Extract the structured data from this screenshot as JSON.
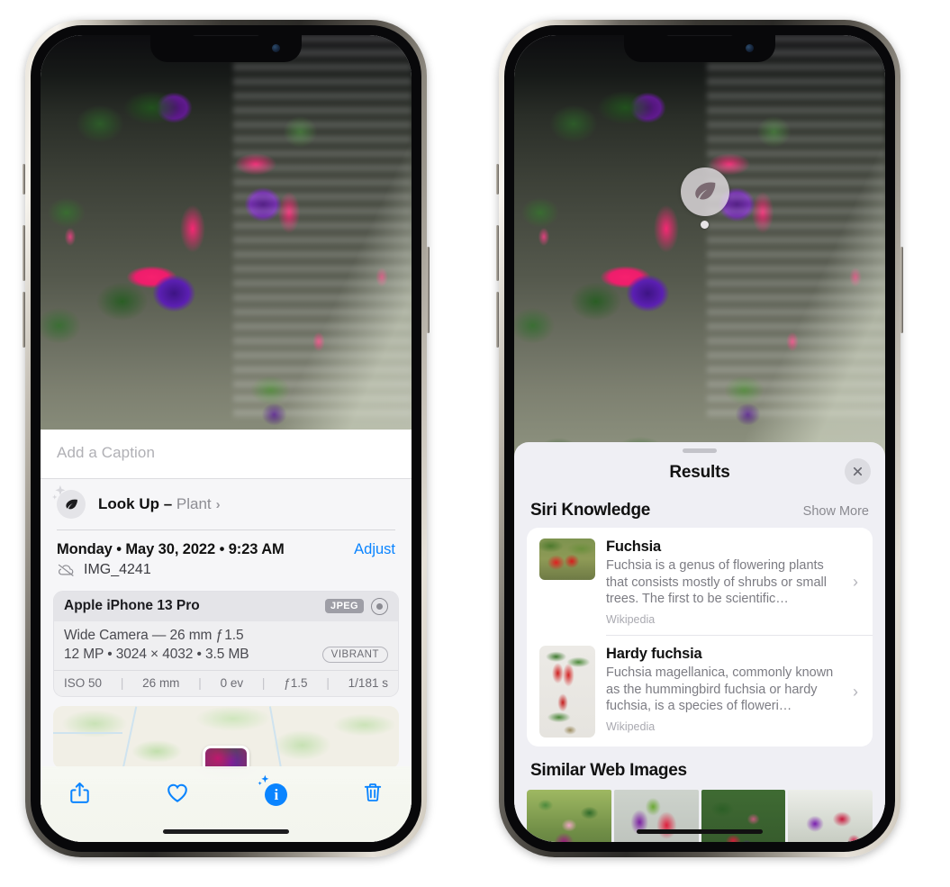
{
  "left_phone": {
    "caption_placeholder": "Add a Caption",
    "lookup": {
      "label": "Look Up – ",
      "subject": "Plant",
      "chevron": "›",
      "icon": "leaf-icon"
    },
    "meta": {
      "date": "Monday • May 30, 2022 • 9:23 AM",
      "adjust": "Adjust",
      "filename": "IMG_4241"
    },
    "camera": {
      "device": "Apple iPhone 13 Pro",
      "format_badge": "JPEG",
      "lens": "Wide Camera — 26 mm ƒ 1.5",
      "specs": "12 MP • 3024 × 4032 • 3.5 MB",
      "style_badge": "VIBRANT",
      "exif": [
        "ISO 50",
        "26 mm",
        "0 ev",
        "ƒ1.5",
        "1/181 s"
      ],
      "exif_sep": "|"
    },
    "toolbar": [
      {
        "name": "share-button",
        "glyph": "share"
      },
      {
        "name": "favorite-button",
        "glyph": "heart"
      },
      {
        "name": "info-button",
        "glyph": "info-sparkle",
        "badge_text": "i"
      },
      {
        "name": "delete-button",
        "glyph": "trash"
      }
    ]
  },
  "right_phone": {
    "visual_lookup_badge": "leaf-icon",
    "sheet": {
      "title": "Results",
      "close_label": "✕"
    },
    "siri_knowledge": {
      "section_title": "Siri Knowledge",
      "show_more": "Show More",
      "items": [
        {
          "name": "Fuchsia",
          "description": "Fuchsia is a genus of flowering plants that consists mostly of shrubs or small trees. The first to be scientific…",
          "source": "Wikipedia",
          "chevron": "›"
        },
        {
          "name": "Hardy fuchsia",
          "description": "Fuchsia magellanica, commonly known as the hummingbird fuchsia or hardy fuchsia, is a species of floweri…",
          "source": "Wikipedia",
          "chevron": "›"
        }
      ]
    },
    "similar_web_images": {
      "section_title": "Similar Web Images",
      "thumbs": [
        "web-image-1",
        "web-image-2",
        "web-image-3",
        "web-image-4"
      ]
    }
  },
  "colors": {
    "accent_blue": "#0a84ff",
    "sheet_bg": "#efeff4",
    "card_bg": "#ffffff",
    "secondary_text": "#8a8a90"
  }
}
